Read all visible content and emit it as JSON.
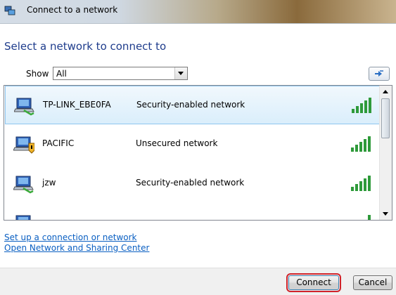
{
  "window": {
    "title": "Connect to a network"
  },
  "heading": "Select a network to connect to",
  "show": {
    "label": "Show",
    "selected": "All"
  },
  "networks": [
    {
      "name": "TP-LINK_EBE0FA",
      "security": "Security-enabled network",
      "icon": "network-secure-icon",
      "signal_bars": 5
    },
    {
      "name": "PACIFIC",
      "security": "Unsecured network",
      "icon": "network-unsecured-icon",
      "signal_bars": 5
    },
    {
      "name": "jzw",
      "security": "Security-enabled network",
      "icon": "network-secure-icon",
      "signal_bars": 5
    }
  ],
  "links": {
    "setup": "Set up a connection or network",
    "sharing_center": "Open Network and Sharing Center"
  },
  "buttons": {
    "connect": "Connect",
    "cancel": "Cancel"
  },
  "colors": {
    "heading": "#1e3c8c",
    "link": "#0a5fc2",
    "selection": "#daeefb",
    "signal": "#2e9a3a",
    "highlight": "#d0232a"
  }
}
